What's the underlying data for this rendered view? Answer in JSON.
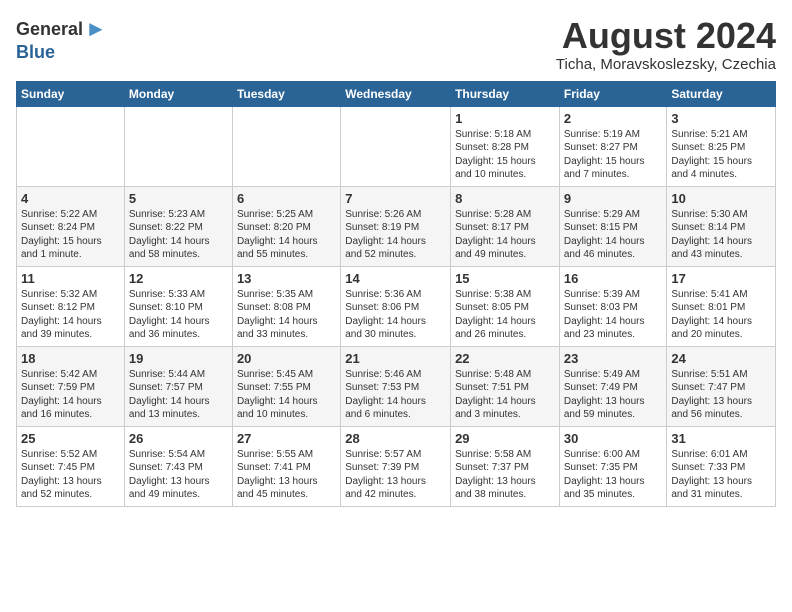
{
  "logo": {
    "general": "General",
    "blue": "Blue",
    "arrow": "▶"
  },
  "title": "August 2024",
  "subtitle": "Ticha, Moravskoslezsky, Czechia",
  "weekdays": [
    "Sunday",
    "Monday",
    "Tuesday",
    "Wednesday",
    "Thursday",
    "Friday",
    "Saturday"
  ],
  "weeks": [
    [
      {
        "day": "",
        "info": ""
      },
      {
        "day": "",
        "info": ""
      },
      {
        "day": "",
        "info": ""
      },
      {
        "day": "",
        "info": ""
      },
      {
        "day": "1",
        "info": "Sunrise: 5:18 AM\nSunset: 8:28 PM\nDaylight: 15 hours\nand 10 minutes."
      },
      {
        "day": "2",
        "info": "Sunrise: 5:19 AM\nSunset: 8:27 PM\nDaylight: 15 hours\nand 7 minutes."
      },
      {
        "day": "3",
        "info": "Sunrise: 5:21 AM\nSunset: 8:25 PM\nDaylight: 15 hours\nand 4 minutes."
      }
    ],
    [
      {
        "day": "4",
        "info": "Sunrise: 5:22 AM\nSunset: 8:24 PM\nDaylight: 15 hours\nand 1 minute."
      },
      {
        "day": "5",
        "info": "Sunrise: 5:23 AM\nSunset: 8:22 PM\nDaylight: 14 hours\nand 58 minutes."
      },
      {
        "day": "6",
        "info": "Sunrise: 5:25 AM\nSunset: 8:20 PM\nDaylight: 14 hours\nand 55 minutes."
      },
      {
        "day": "7",
        "info": "Sunrise: 5:26 AM\nSunset: 8:19 PM\nDaylight: 14 hours\nand 52 minutes."
      },
      {
        "day": "8",
        "info": "Sunrise: 5:28 AM\nSunset: 8:17 PM\nDaylight: 14 hours\nand 49 minutes."
      },
      {
        "day": "9",
        "info": "Sunrise: 5:29 AM\nSunset: 8:15 PM\nDaylight: 14 hours\nand 46 minutes."
      },
      {
        "day": "10",
        "info": "Sunrise: 5:30 AM\nSunset: 8:14 PM\nDaylight: 14 hours\nand 43 minutes."
      }
    ],
    [
      {
        "day": "11",
        "info": "Sunrise: 5:32 AM\nSunset: 8:12 PM\nDaylight: 14 hours\nand 39 minutes."
      },
      {
        "day": "12",
        "info": "Sunrise: 5:33 AM\nSunset: 8:10 PM\nDaylight: 14 hours\nand 36 minutes."
      },
      {
        "day": "13",
        "info": "Sunrise: 5:35 AM\nSunset: 8:08 PM\nDaylight: 14 hours\nand 33 minutes."
      },
      {
        "day": "14",
        "info": "Sunrise: 5:36 AM\nSunset: 8:06 PM\nDaylight: 14 hours\nand 30 minutes."
      },
      {
        "day": "15",
        "info": "Sunrise: 5:38 AM\nSunset: 8:05 PM\nDaylight: 14 hours\nand 26 minutes."
      },
      {
        "day": "16",
        "info": "Sunrise: 5:39 AM\nSunset: 8:03 PM\nDaylight: 14 hours\nand 23 minutes."
      },
      {
        "day": "17",
        "info": "Sunrise: 5:41 AM\nSunset: 8:01 PM\nDaylight: 14 hours\nand 20 minutes."
      }
    ],
    [
      {
        "day": "18",
        "info": "Sunrise: 5:42 AM\nSunset: 7:59 PM\nDaylight: 14 hours\nand 16 minutes."
      },
      {
        "day": "19",
        "info": "Sunrise: 5:44 AM\nSunset: 7:57 PM\nDaylight: 14 hours\nand 13 minutes."
      },
      {
        "day": "20",
        "info": "Sunrise: 5:45 AM\nSunset: 7:55 PM\nDaylight: 14 hours\nand 10 minutes."
      },
      {
        "day": "21",
        "info": "Sunrise: 5:46 AM\nSunset: 7:53 PM\nDaylight: 14 hours\nand 6 minutes."
      },
      {
        "day": "22",
        "info": "Sunrise: 5:48 AM\nSunset: 7:51 PM\nDaylight: 14 hours\nand 3 minutes."
      },
      {
        "day": "23",
        "info": "Sunrise: 5:49 AM\nSunset: 7:49 PM\nDaylight: 13 hours\nand 59 minutes."
      },
      {
        "day": "24",
        "info": "Sunrise: 5:51 AM\nSunset: 7:47 PM\nDaylight: 13 hours\nand 56 minutes."
      }
    ],
    [
      {
        "day": "25",
        "info": "Sunrise: 5:52 AM\nSunset: 7:45 PM\nDaylight: 13 hours\nand 52 minutes."
      },
      {
        "day": "26",
        "info": "Sunrise: 5:54 AM\nSunset: 7:43 PM\nDaylight: 13 hours\nand 49 minutes."
      },
      {
        "day": "27",
        "info": "Sunrise: 5:55 AM\nSunset: 7:41 PM\nDaylight: 13 hours\nand 45 minutes."
      },
      {
        "day": "28",
        "info": "Sunrise: 5:57 AM\nSunset: 7:39 PM\nDaylight: 13 hours\nand 42 minutes."
      },
      {
        "day": "29",
        "info": "Sunrise: 5:58 AM\nSunset: 7:37 PM\nDaylight: 13 hours\nand 38 minutes."
      },
      {
        "day": "30",
        "info": "Sunrise: 6:00 AM\nSunset: 7:35 PM\nDaylight: 13 hours\nand 35 minutes."
      },
      {
        "day": "31",
        "info": "Sunrise: 6:01 AM\nSunset: 7:33 PM\nDaylight: 13 hours\nand 31 minutes."
      }
    ]
  ]
}
